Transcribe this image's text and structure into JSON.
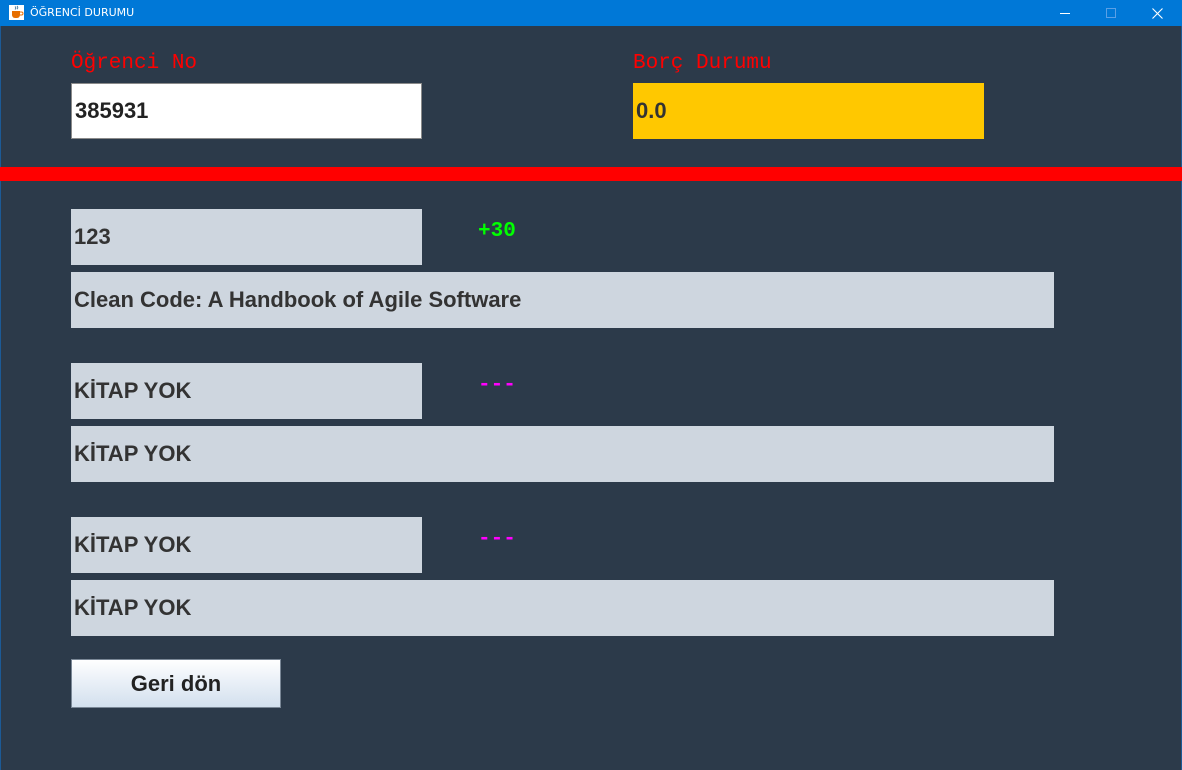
{
  "window": {
    "title": "ÖĞRENCİ DURUMU",
    "app_icon": "java-cup-icon",
    "minimize_icon": "minimize-icon",
    "maximize_icon": "maximize-icon",
    "close_icon": "close-icon"
  },
  "colors": {
    "titlebar": "#0078d7",
    "background": "#2c3a4a",
    "label_red": "#ff0000",
    "debt_field": "#ffc800",
    "book_field": "#ced6df",
    "status_ok": "#00ff00",
    "status_none": "#ff00ff",
    "divider": "#ff0000"
  },
  "student": {
    "no_label": "Öğrenci No",
    "no_value": "385931",
    "debt_label": "Borç Durumu",
    "debt_value": "0.0"
  },
  "books": [
    {
      "id": "123",
      "status": "+30",
      "title": "Clean Code: A Handbook of Agile Software"
    },
    {
      "id": "KİTAP YOK",
      "status": "---",
      "title": "KİTAP YOK"
    },
    {
      "id": "KİTAP YOK",
      "status": "---",
      "title": "KİTAP YOK"
    }
  ],
  "back_button": "Geri dön"
}
